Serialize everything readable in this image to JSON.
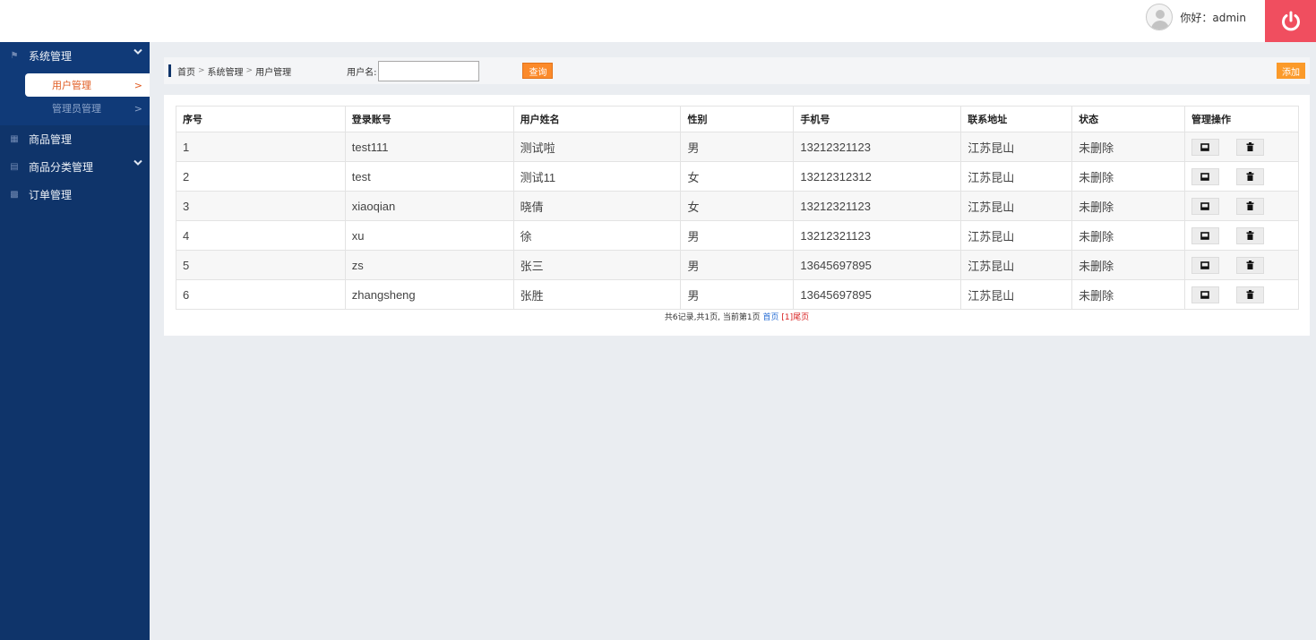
{
  "header": {
    "greeting": "你好：admin"
  },
  "sidebar": {
    "groups": [
      {
        "label": "系统管理",
        "icon": "home-icon",
        "expanded": true,
        "items": [
          {
            "label": "用户管理",
            "arrow": ">",
            "selected": true
          },
          {
            "label": "管理员管理",
            "arrow": ">",
            "selected": false
          }
        ]
      },
      {
        "label": "商品管理",
        "icon": "calendar-icon"
      },
      {
        "label": "商品分类管理",
        "icon": "grid-icon",
        "caret": true
      },
      {
        "label": "订单管理",
        "icon": "list-icon"
      }
    ]
  },
  "toolbar": {
    "breadcrumb": [
      "首页",
      "系统管理",
      "用户管理"
    ],
    "breadcrumb_sep": ">",
    "search_label": "用户名:",
    "search_value": "",
    "query_label": "查询",
    "add_label": "添加"
  },
  "table": {
    "columns": [
      "序号",
      "登录账号",
      "用户姓名",
      "性别",
      "手机号",
      "联系地址",
      "状态",
      "管理操作"
    ],
    "rows": [
      [
        "1",
        "test111",
        "测试啦",
        "男",
        "13212321123",
        "江苏昆山",
        "未删除"
      ],
      [
        "2",
        "test",
        "测试11",
        "女",
        "13212312312",
        "江苏昆山",
        "未删除"
      ],
      [
        "3",
        "xiaoqian",
        "晓倩",
        "女",
        "13212321123",
        "江苏昆山",
        "未删除"
      ],
      [
        "4",
        "xu",
        "徐",
        "男",
        "13212321123",
        "江苏昆山",
        "未删除"
      ],
      [
        "5",
        "zs",
        "张三",
        "男",
        "13645697895",
        "江苏昆山",
        "未删除"
      ],
      [
        "6",
        "zhangsheng",
        "张胜",
        "男",
        "13645697895",
        "江苏昆山",
        "未删除"
      ]
    ]
  },
  "pager": {
    "summary": "共6记录,共1页, 当前第1页",
    "first": "首页",
    "current": "[1]",
    "last": "尾页"
  },
  "colors": {
    "sidebar_bg": "#0f346a",
    "accent_orange": "#fb8a2a",
    "power_red": "#f04e5f",
    "selected_text": "#e05b21"
  }
}
